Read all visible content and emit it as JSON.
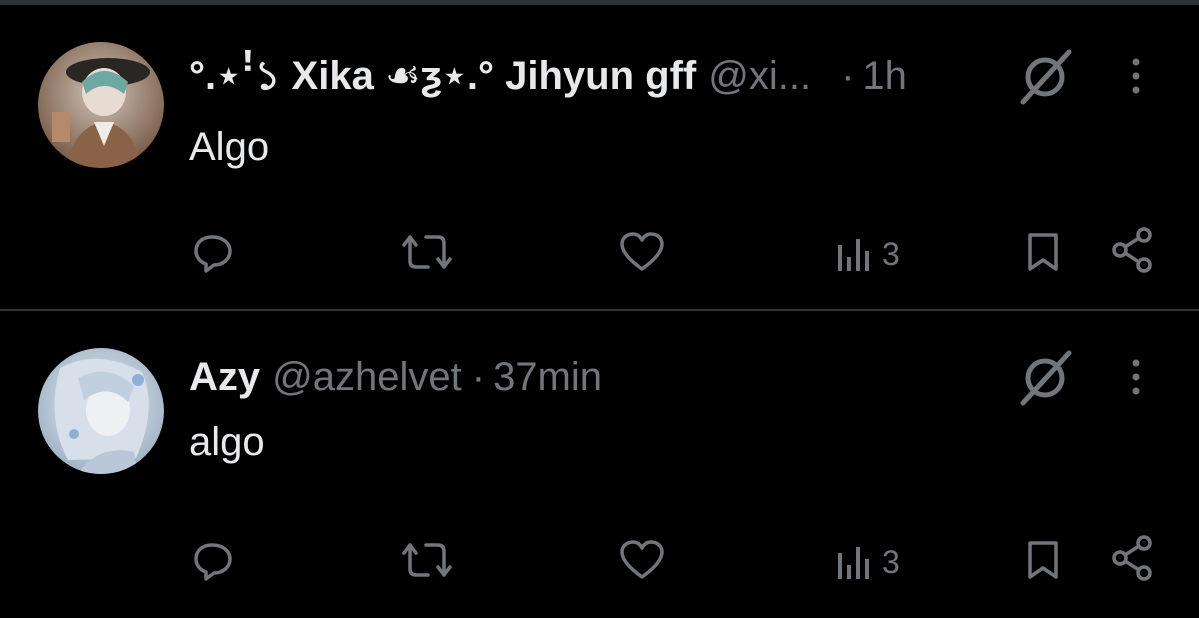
{
  "tweets": [
    {
      "display_name": "°.⋆ꜝ১ Xika ☙ƺ⋆.° Jihyun gff",
      "handle": "@xi...",
      "separator": "·",
      "time": "1h",
      "text": "Algo",
      "views": "3",
      "avatar_icon": "avatar-image",
      "avatar_colors": [
        "#3a2a22",
        "#7a5a44",
        "#cfd4d8"
      ]
    },
    {
      "display_name": "Azy",
      "handle": "@azhelvet",
      "separator": "·",
      "time": "37min",
      "text": "algo",
      "views": "3",
      "avatar_icon": "avatar-image",
      "avatar_colors": [
        "#8aa1b8",
        "#d7e0ea",
        "#f4f6f8"
      ]
    }
  ],
  "icons": {
    "reply": "reply-icon",
    "retweet": "retweet-icon",
    "like": "like-icon",
    "views": "views-icon",
    "bookmark": "bookmark-icon",
    "share": "share-icon",
    "grok": "grok-icon",
    "more": "more-options-icon"
  },
  "colors": {
    "background": "#000000",
    "text_primary": "#e7e9ea",
    "text_secondary": "#71767b",
    "divider": "#2f3336"
  }
}
